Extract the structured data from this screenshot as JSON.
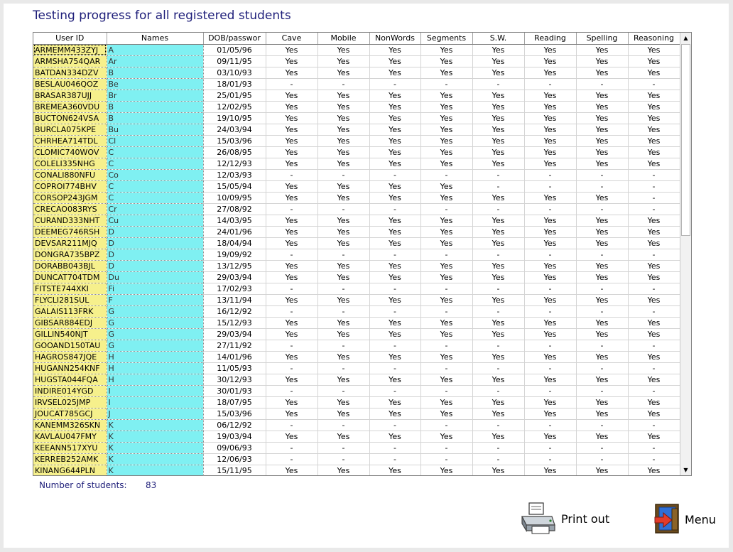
{
  "title": "Testing progress for all registered students",
  "table": {
    "columns": [
      "User ID",
      "Names",
      "DOB/passwor",
      "Cave",
      "Mobile",
      "NonWords",
      "Segments",
      "S.W.",
      "Reading",
      "Spelling",
      "Reasoning"
    ],
    "rows": [
      {
        "id": "ARMEMM433ZYJ",
        "name": "A",
        "dob": "01/05/96",
        "r": [
          "Yes",
          "Yes",
          "Yes",
          "Yes",
          "Yes",
          "Yes",
          "Yes",
          "Yes"
        ]
      },
      {
        "id": "ARMSHA754QAR",
        "name": "Ar",
        "dob": "09/11/95",
        "r": [
          "Yes",
          "Yes",
          "Yes",
          "Yes",
          "Yes",
          "Yes",
          "Yes",
          "Yes"
        ]
      },
      {
        "id": "BATDAN334DZV",
        "name": "B",
        "dob": "03/10/93",
        "r": [
          "Yes",
          "Yes",
          "Yes",
          "Yes",
          "Yes",
          "Yes",
          "Yes",
          "Yes"
        ]
      },
      {
        "id": "BESLAU046QOZ",
        "name": "Be",
        "dob": "18/01/93",
        "r": [
          "-",
          "-",
          "-",
          "-",
          "-",
          "-",
          "-",
          "-"
        ]
      },
      {
        "id": "BRASAR387UJJ",
        "name": "Br",
        "dob": "25/01/95",
        "r": [
          "Yes",
          "Yes",
          "Yes",
          "Yes",
          "Yes",
          "Yes",
          "Yes",
          "Yes"
        ]
      },
      {
        "id": "BREMEA360VDU",
        "name": "B",
        "dob": "12/02/95",
        "r": [
          "Yes",
          "Yes",
          "Yes",
          "Yes",
          "Yes",
          "Yes",
          "Yes",
          "Yes"
        ]
      },
      {
        "id": "BUCTON624VSA",
        "name": "B",
        "dob": "19/10/95",
        "r": [
          "Yes",
          "Yes",
          "Yes",
          "Yes",
          "Yes",
          "Yes",
          "Yes",
          "Yes"
        ]
      },
      {
        "id": "BURCLA075KPE",
        "name": "Bu",
        "dob": "24/03/94",
        "r": [
          "Yes",
          "Yes",
          "Yes",
          "Yes",
          "Yes",
          "Yes",
          "Yes",
          "Yes"
        ]
      },
      {
        "id": "CHRHEA714TDL",
        "name": "Cl",
        "dob": "15/03/96",
        "r": [
          "Yes",
          "Yes",
          "Yes",
          "Yes",
          "Yes",
          "Yes",
          "Yes",
          "Yes"
        ]
      },
      {
        "id": "CLOMIC740WOV",
        "name": "C",
        "dob": "26/08/95",
        "r": [
          "Yes",
          "Yes",
          "Yes",
          "Yes",
          "Yes",
          "Yes",
          "Yes",
          "Yes"
        ]
      },
      {
        "id": "COLELI335NHG",
        "name": "C",
        "dob": "12/12/93",
        "r": [
          "Yes",
          "Yes",
          "Yes",
          "Yes",
          "Yes",
          "Yes",
          "Yes",
          "Yes"
        ]
      },
      {
        "id": "CONALI880NFU",
        "name": "Co",
        "dob": "12/03/93",
        "r": [
          "-",
          "-",
          "-",
          "-",
          "-",
          "-",
          "-",
          "-"
        ]
      },
      {
        "id": "COPROI774BHV",
        "name": "C",
        "dob": "15/05/94",
        "r": [
          "Yes",
          "Yes",
          "Yes",
          "Yes",
          "-",
          "-",
          "-",
          "-"
        ]
      },
      {
        "id": "CORSOP243JGM",
        "name": "C",
        "dob": "10/09/95",
        "r": [
          "Yes",
          "Yes",
          "Yes",
          "Yes",
          "Yes",
          "Yes",
          "Yes",
          "-"
        ]
      },
      {
        "id": "CRECAO083RYS",
        "name": "Cr",
        "dob": "27/08/92",
        "r": [
          "-",
          "-",
          "-",
          "-",
          "-",
          "-",
          "-",
          "-"
        ]
      },
      {
        "id": "CURAND333NHT",
        "name": "Cu",
        "dob": "14/03/95",
        "r": [
          "Yes",
          "Yes",
          "Yes",
          "Yes",
          "Yes",
          "Yes",
          "Yes",
          "Yes"
        ]
      },
      {
        "id": "DEEMEG746RSH",
        "name": "D",
        "dob": "24/01/96",
        "r": [
          "Yes",
          "Yes",
          "Yes",
          "Yes",
          "Yes",
          "Yes",
          "Yes",
          "Yes"
        ]
      },
      {
        "id": "DEVSAR211MJQ",
        "name": "D",
        "dob": "18/04/94",
        "r": [
          "Yes",
          "Yes",
          "Yes",
          "Yes",
          "Yes",
          "Yes",
          "Yes",
          "Yes"
        ]
      },
      {
        "id": "DONGRA735BPZ",
        "name": "D",
        "dob": "19/09/92",
        "r": [
          "-",
          "-",
          "-",
          "-",
          "-",
          "-",
          "-",
          "-"
        ]
      },
      {
        "id": "DORABB043BJL",
        "name": "D",
        "dob": "13/12/95",
        "r": [
          "Yes",
          "Yes",
          "Yes",
          "Yes",
          "Yes",
          "Yes",
          "Yes",
          "Yes"
        ]
      },
      {
        "id": "DUNCAT704TDM",
        "name": "Du",
        "dob": "29/03/94",
        "r": [
          "Yes",
          "Yes",
          "Yes",
          "Yes",
          "Yes",
          "Yes",
          "Yes",
          "Yes"
        ]
      },
      {
        "id": "FITSTE744XKI",
        "name": "Fi",
        "dob": "17/02/93",
        "r": [
          "-",
          "-",
          "-",
          "-",
          "-",
          "-",
          "-",
          "-"
        ]
      },
      {
        "id": "FLYCLI281SUL",
        "name": "F",
        "dob": "13/11/94",
        "r": [
          "Yes",
          "Yes",
          "Yes",
          "Yes",
          "Yes",
          "Yes",
          "Yes",
          "Yes"
        ]
      },
      {
        "id": "GALAIS113FRK",
        "name": "G",
        "dob": "16/12/92",
        "r": [
          "-",
          "-",
          "-",
          "-",
          "-",
          "-",
          "-",
          "-"
        ]
      },
      {
        "id": "GIBSAR884EDJ",
        "name": "G",
        "dob": "15/12/93",
        "r": [
          "Yes",
          "Yes",
          "Yes",
          "Yes",
          "Yes",
          "Yes",
          "Yes",
          "Yes"
        ]
      },
      {
        "id": "GILLIN540NJT",
        "name": "G",
        "dob": "29/03/94",
        "r": [
          "Yes",
          "Yes",
          "Yes",
          "Yes",
          "Yes",
          "Yes",
          "Yes",
          "Yes"
        ]
      },
      {
        "id": "GOOAND150TAU",
        "name": "G",
        "dob": "27/11/92",
        "r": [
          "-",
          "-",
          "-",
          "-",
          "-",
          "-",
          "-",
          "-"
        ]
      },
      {
        "id": "HAGROS847JQE",
        "name": "H",
        "dob": "14/01/96",
        "r": [
          "Yes",
          "Yes",
          "Yes",
          "Yes",
          "Yes",
          "Yes",
          "Yes",
          "Yes"
        ]
      },
      {
        "id": "HUGANN254KNF",
        "name": "H",
        "dob": "11/05/93",
        "r": [
          "-",
          "-",
          "-",
          "-",
          "-",
          "-",
          "-",
          "-"
        ]
      },
      {
        "id": "HUGSTA044FQA",
        "name": "H",
        "dob": "30/12/93",
        "r": [
          "Yes",
          "Yes",
          "Yes",
          "Yes",
          "Yes",
          "Yes",
          "Yes",
          "Yes"
        ]
      },
      {
        "id": "INDIRE014YGD",
        "name": "I",
        "dob": "30/01/93",
        "r": [
          "-",
          "-",
          "-",
          "-",
          "-",
          "-",
          "-",
          "-"
        ]
      },
      {
        "id": "IRVSEL025JMP",
        "name": "I",
        "dob": "18/07/95",
        "r": [
          "Yes",
          "Yes",
          "Yes",
          "Yes",
          "Yes",
          "Yes",
          "Yes",
          "Yes"
        ]
      },
      {
        "id": "JOUCAT785GCJ",
        "name": "J",
        "dob": "15/03/96",
        "r": [
          "Yes",
          "Yes",
          "Yes",
          "Yes",
          "Yes",
          "Yes",
          "Yes",
          "Yes"
        ]
      },
      {
        "id": "KANEMM326SKN",
        "name": "K",
        "dob": "06/12/92",
        "r": [
          "-",
          "-",
          "-",
          "-",
          "-",
          "-",
          "-",
          "-"
        ]
      },
      {
        "id": "KAVLAU047FMY",
        "name": "K",
        "dob": "19/03/94",
        "r": [
          "Yes",
          "Yes",
          "Yes",
          "Yes",
          "Yes",
          "Yes",
          "Yes",
          "Yes"
        ]
      },
      {
        "id": "KEEANN517XYU",
        "name": "K",
        "dob": "09/06/93",
        "r": [
          "-",
          "-",
          "-",
          "-",
          "-",
          "-",
          "-",
          "-"
        ]
      },
      {
        "id": "KERREB252AMK",
        "name": "K",
        "dob": "12/06/93",
        "r": [
          "-",
          "-",
          "-",
          "-",
          "-",
          "-",
          "-",
          "-"
        ]
      },
      {
        "id": "KINANG644PLN",
        "name": "K",
        "dob": "15/11/95",
        "r": [
          "Yes",
          "Yes",
          "Yes",
          "Yes",
          "Yes",
          "Yes",
          "Yes",
          "Yes"
        ]
      }
    ]
  },
  "footer": {
    "count_label": "Number of students:",
    "count_value": "83"
  },
  "buttons": {
    "print_label": "Print out",
    "menu_label": "Menu"
  },
  "icons": {
    "print": "printer-icon",
    "menu": "exit-door-icon",
    "scroll_up": "scroll-up-arrow-icon",
    "scroll_down": "scroll-down-arrow-icon"
  },
  "colors": {
    "title_text": "#1f1f7a",
    "user_id_cell": "#f6f08c",
    "names_cell": "#7ff0f2"
  }
}
